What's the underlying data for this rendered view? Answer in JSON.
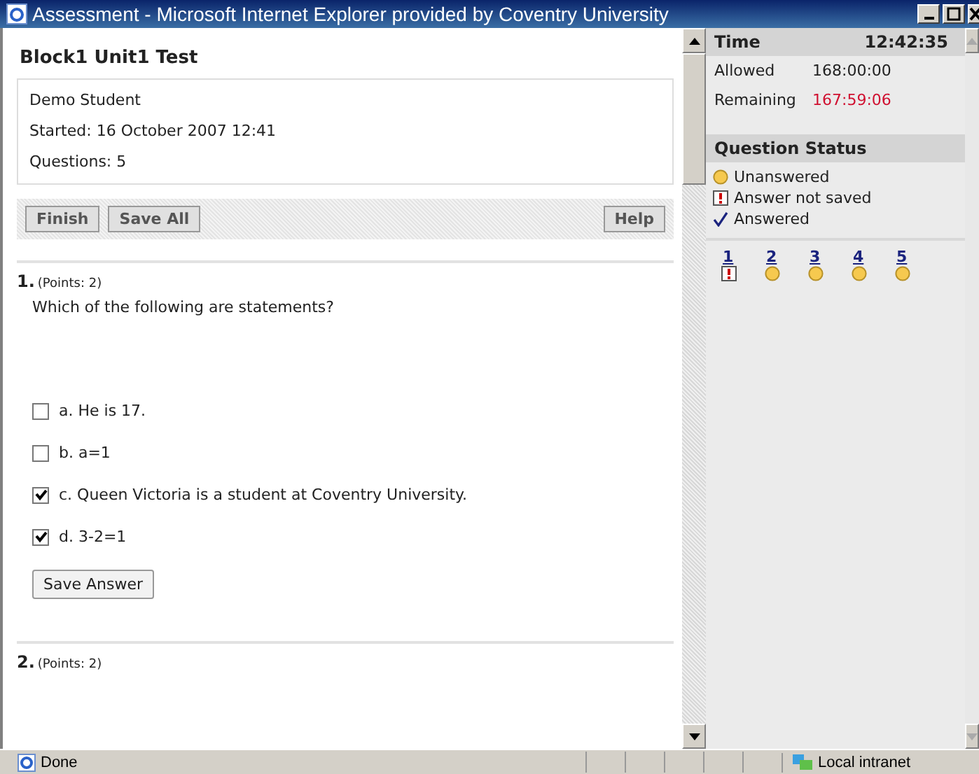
{
  "window": {
    "title": "Assessment - Microsoft Internet Explorer provided by Coventry University"
  },
  "test": {
    "title": "Block1 Unit1 Test",
    "student": "Demo Student",
    "started": "Started: 16 October 2007 12:41",
    "questions": "Questions: 5"
  },
  "toolbar": {
    "left_buttons": [
      "Finish",
      "Save All"
    ],
    "right_buttons": [
      "Help"
    ]
  },
  "question": {
    "number": "1.",
    "points": "(Points: 2)",
    "text": "Which of the following are statements?",
    "options": [
      {
        "label": "a. He is 17.",
        "checked": false
      },
      {
        "label": "b. a=1",
        "checked": false
      },
      {
        "label": "c. Queen Victoria is a student at Coventry University.",
        "checked": true
      },
      {
        "label": "d. 3-2=1",
        "checked": true
      }
    ],
    "button": "Save Answer"
  },
  "next_question": {
    "number": "2.",
    "points": "(Points: 2)"
  },
  "time": {
    "label": "Time",
    "value": "12:42:35",
    "rows": [
      {
        "label": "Allowed",
        "value": "168:00:00",
        "kind": "normal"
      },
      {
        "label": "Remaining",
        "value": "167:59:06",
        "kind": "alert"
      }
    ]
  },
  "question_status": {
    "title": "Question Status",
    "legend": [
      {
        "kind": "unanswered",
        "label": "Unanswered"
      },
      {
        "kind": "not_saved",
        "label": "Answer not saved"
      },
      {
        "kind": "answered",
        "label": "Answered"
      }
    ],
    "questions": [
      {
        "label": "1",
        "kind": "not_saved"
      },
      {
        "label": "2",
        "kind": "unanswered"
      },
      {
        "label": "3",
        "kind": "unanswered"
      },
      {
        "label": "4",
        "kind": "unanswered"
      },
      {
        "label": "5",
        "kind": "unanswered"
      }
    ]
  },
  "status_bar": {
    "text": "Done",
    "zone": "Local intranet"
  }
}
